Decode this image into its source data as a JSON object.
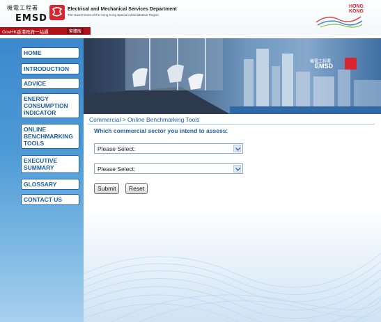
{
  "header": {
    "org_chinese": "機電工程署",
    "org_abbr": "EMSD",
    "dept_title": "Electrical and Mechanical Services Department",
    "dept_subtitle": "The Government of the Hong Kong Special Administrative Region",
    "brand_text": "HONG KONG"
  },
  "govbar": {
    "link": "GovHK香港政府一站通",
    "lang": "繁體版"
  },
  "sidebar": {
    "items": [
      {
        "label": "HOME"
      },
      {
        "label": "INTRODUCTION"
      },
      {
        "label": "ADVICE"
      },
      {
        "label": "ENERGY CONSUMPTION INDICATOR"
      },
      {
        "label": "ONLINE BENCHMARKING TOOLS"
      },
      {
        "label": "EXECUTIVE SUMMARY"
      },
      {
        "label": "GLOSSARY"
      },
      {
        "label": "CONTACT US"
      }
    ]
  },
  "banner": {
    "logo_cn": "機電工程署",
    "logo_en": "EMSD"
  },
  "main": {
    "breadcrumb": "Commercial > Online Benchmarking Tools",
    "question": "Which commercial sector you intend to assess:",
    "select1_value": "Please Select:",
    "select2_value": "Please Select:",
    "submit_label": "Submit",
    "reset_label": "Reset"
  },
  "colors": {
    "nav_text": "#1a5fa6",
    "brand_red": "#d9252d",
    "sidebar_blue": "#3c88cc"
  }
}
